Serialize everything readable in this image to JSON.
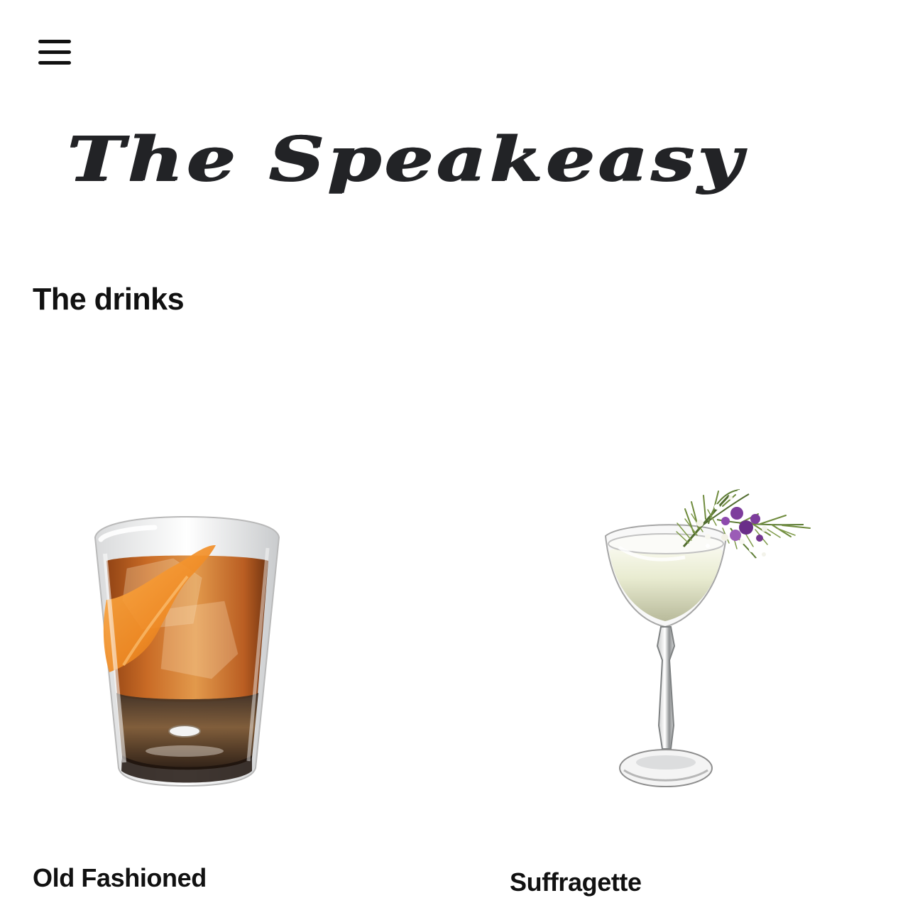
{
  "header": {
    "menu_icon": "hamburger-menu-icon",
    "logo_title": "The Speakeasy"
  },
  "main": {
    "section_title": "The drinks",
    "drinks": [
      {
        "name": "Old Fashioned",
        "image_icon": "old-fashioned-glass-image",
        "colors": {
          "liquid": "#c7651d",
          "orange_peel": "#f08b24"
        }
      },
      {
        "name": "Suffragette",
        "image_icon": "coupe-glass-with-flower-garnish-image",
        "colors": {
          "liquid": "#e8ebcf",
          "garnish_flowers": "#7d3d9c"
        }
      }
    ]
  }
}
